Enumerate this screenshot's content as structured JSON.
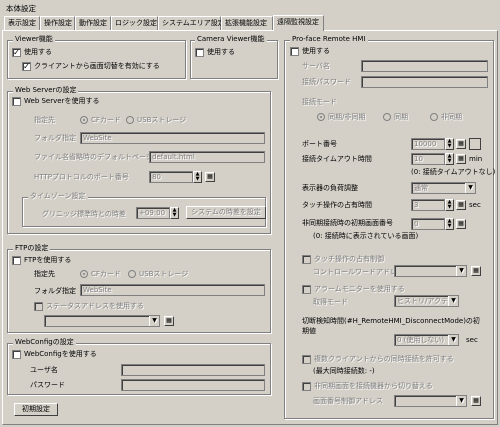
{
  "window_title": "本体設定",
  "tabs": [
    "表示設定",
    "操作設定",
    "動作設定",
    "ロジック設定",
    "システムエリア設定",
    "拡張機能設定",
    "遠隔監視設定"
  ],
  "viewer": {
    "title": "Viewer機能",
    "enable": "使用する",
    "client_switch": "クライアントから画面切替を有効にする"
  },
  "camera": {
    "title": "Camera Viewer機能",
    "enable": "使用する"
  },
  "web": {
    "title": "Web Serverの設定",
    "enable": "Web Serverを使用する",
    "dest_label": "指定先",
    "dest_cf": "CFカード",
    "dest_usb": "USBストレージ",
    "folder_label": "フォルダ指定",
    "folder_value": "WebSite",
    "default_page_label": "ファイル名省略時のデフォルトページ",
    "default_page_value": "default.html",
    "port_label": "HTTPプロトコルのポート番号",
    "port_value": "80",
    "tz_title": "タイムゾーン設定",
    "tz_label": "グリニッジ標準時との時差",
    "tz_value": "+09:00",
    "tz_button": "システムの時差を設定"
  },
  "ftp": {
    "title": "FTPの設定",
    "enable": "FTPを使用する",
    "dest_label": "指定先",
    "dest_cf": "CFカード",
    "dest_usb": "USBストレージ",
    "folder_label": "フォルダ指定",
    "folder_value": "WebSite",
    "status_addr": "ステータスアドレスを使用する"
  },
  "webconfig": {
    "title": "WebConfigの設定",
    "enable": "WebConfigを使用する",
    "user_label": "ユーザ名",
    "pass_label": "パスワード"
  },
  "init_button": "初期設定",
  "remote": {
    "title": "Pro-face Remote HMI",
    "enable": "使用する",
    "server_name": "サーバ名",
    "password": "接続パスワード",
    "mode_label": "接続モード",
    "mode_sync": "同期/非同期",
    "mode_sync_only": "同期",
    "mode_async": "非同期",
    "port_label": "ポート番号",
    "port_value": "10000",
    "timeout_label": "接続タイムアウト時間",
    "timeout_value": "10",
    "timeout_unit": "min",
    "timeout_note": "(0: 接続タイムアウトなし)",
    "load_label": "表示器の負荷調整",
    "load_value": "通常",
    "touch_label": "タッチ操作の占有時間",
    "touch_value": "3",
    "touch_unit": "sec",
    "async_label": "非同期接続時の初期画面番号",
    "async_value": "0",
    "async_note": "(0: 接続時に表示されている画面)",
    "touch_occupy": "タッチ操作の占有制御",
    "ctrl_word": "コントロールワードアドレス",
    "alarm": "アラームモニターを使用する",
    "acquire_mode": "取得モード",
    "acquire_value": "ヒストリ/アクティブ",
    "disconnect_label": "切断検知時間(#H_RemoteHMI_DisconnectMode)の初期値",
    "disconnect_value": "0 (使用しない)",
    "disconnect_unit": "sec",
    "multi_client": "複数クライアントからの同時接続を許可する",
    "max_conn": "(最大同時接続数: -)",
    "async_switch": "非同期画面を接続機器から切り替える",
    "screen_ctrl": "画面番号制御アドレス"
  }
}
